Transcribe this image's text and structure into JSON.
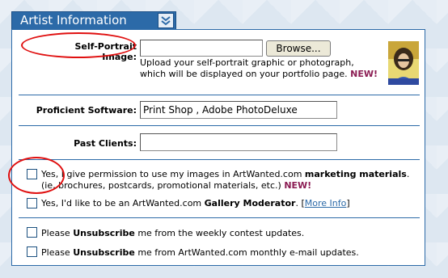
{
  "section": {
    "title": "Artist Information"
  },
  "self_portrait": {
    "label": "Self-Portrait Image:",
    "browse_label": "Browse...",
    "help_line1": "Upload your self-portrait graphic or photograph,",
    "help_line2": "which will be displayed on your portfolio page.",
    "new_badge": "NEW!"
  },
  "software": {
    "label": "Proficient Software:",
    "value": "Print Shop , Adobe PhotoDeluxe"
  },
  "clients": {
    "label": "Past Clients:",
    "value": ""
  },
  "marketing": {
    "text_prefix": "Yes, I give permission to use my images in ArtWanted.com",
    "text_bold": "marketing materials",
    "text_suffix": ".",
    "line2": "(ie, brochures, postcards, promotional materials, etc.)",
    "new_badge": "NEW!",
    "checked": false
  },
  "moderator": {
    "text_prefix": "Yes, I'd like to be an ArtWanted.com",
    "text_bold": "Gallery Moderator",
    "text_mid": ". [",
    "link": "More Info",
    "text_suffix": "]",
    "checked": false
  },
  "unsub_contest": {
    "prefix": "Please",
    "bold": "Unsubscribe",
    "suffix": "me from the weekly contest updates.",
    "checked": false
  },
  "unsub_monthly": {
    "prefix": "Please",
    "bold": "Unsubscribe",
    "suffix": "me from ArtWanted.com monthly e-mail updates.",
    "checked": false
  },
  "colors": {
    "header_blue": "#2c6aa8",
    "new_badge": "#8b1c53",
    "annotation_red": "#e01010"
  }
}
